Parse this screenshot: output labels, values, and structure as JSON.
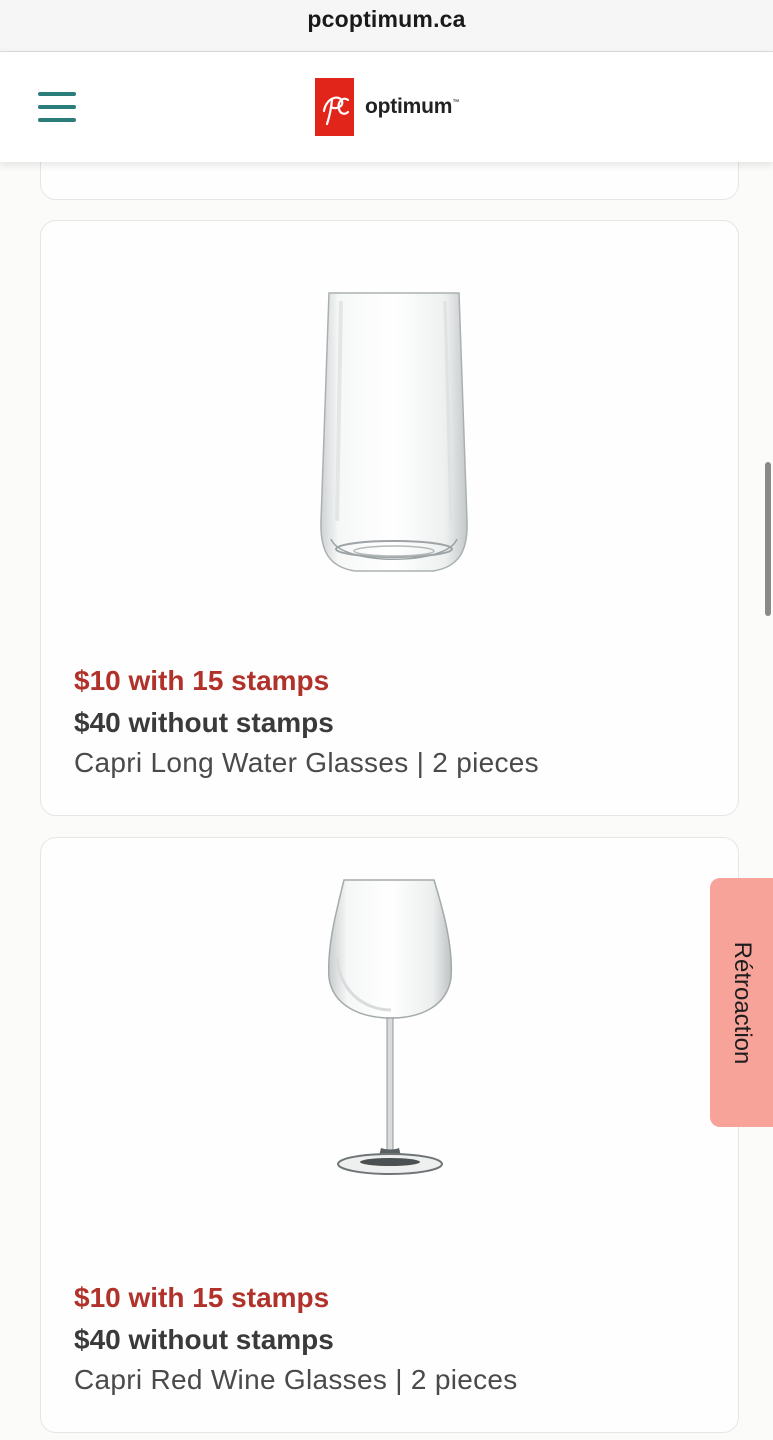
{
  "browser": {
    "url": "pcoptimum.ca"
  },
  "header": {
    "logo_text": "optimum",
    "logo_tm": "™",
    "logo_brand": "PC"
  },
  "products": [
    {
      "price_with_stamps": "$10 with 15 stamps",
      "price_without_stamps": "$40 without stamps",
      "description": "Capri Long Water Glasses | 2 pieces",
      "image_icon": "water-glass-icon"
    },
    {
      "price_with_stamps": "$10 with 15 stamps",
      "price_without_stamps": "$40 without stamps",
      "description": "Capri Red Wine Glasses | 2 pieces",
      "image_icon": "wine-glass-icon"
    }
  ],
  "feedback": {
    "label": "Rétroaction"
  },
  "colors": {
    "accent_teal": "#2b7d7a",
    "brand_red": "#e1251b",
    "stamp_price": "#b0322a",
    "feedback_bg": "#f7a399"
  }
}
